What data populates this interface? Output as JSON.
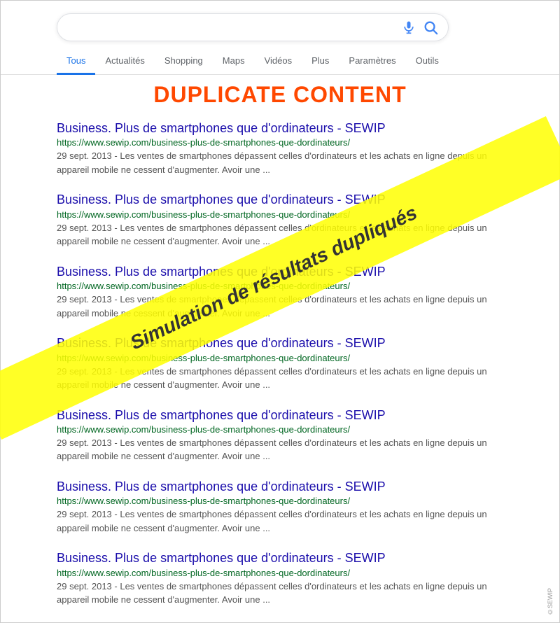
{
  "searchbar": {
    "placeholder": "",
    "value": ""
  },
  "nav": {
    "tabs": [
      {
        "label": "Tous",
        "active": true
      },
      {
        "label": "Actualités",
        "active": false
      },
      {
        "label": "Shopping",
        "active": false
      },
      {
        "label": "Maps",
        "active": false
      },
      {
        "label": "Vidéos",
        "active": false
      },
      {
        "label": "Plus",
        "active": false
      },
      {
        "label": "Paramètres",
        "active": false
      },
      {
        "label": "Outils",
        "active": false
      }
    ]
  },
  "header": {
    "title": "DUPLICATE CONTENT"
  },
  "banner": {
    "text": "Simulation de résultats dupliqués"
  },
  "results": [
    {
      "title": "Business. Plus de smartphones que d'ordinateurs - SEWIP",
      "url": "https://www.sewip.com/business-plus-de-smartphones-que-dordinateurs/",
      "snippet": "29 sept. 2013 - Les ventes de smartphones dépassent celles d'ordinateurs et les achats en ligne depuis un appareil mobile ne cessent d'augmenter. Avoir une ..."
    },
    {
      "title": "Business. Plus de smartphones que d'ordinateurs - SEWIP",
      "url": "https://www.sewip.com/business-plus-de-smartphones-que-dordinateurs/",
      "snippet": "29 sept. 2013 - Les ventes de smartphones dépassent celles d'ordinateurs et les achats en ligne depuis un appareil mobile ne cessent d'augmenter. Avoir une ..."
    },
    {
      "title": "Business. Plus de smartphones que d'ordinateurs - SEWIP",
      "url": "https://www.sewip.com/business-plus-de-smartphones-que-dordinateurs/",
      "snippet": "29 sept. 2013 - Les ventes de smartphones dépassent celles d'ordinateurs et les achats en ligne depuis un appareil mobile ne cessent d'augmenter. Avoir une ..."
    },
    {
      "title": "Business. Plus de smartphones que d'ordinateurs - SEWIP",
      "url": "https://www.sewip.com/business-plus-de-smartphones-que-dordinateurs/",
      "snippet": "29 sept. 2013 - Les ventes de smartphones dépassent celles d'ordinateurs et les achats en ligne depuis un appareil mobile ne cessent d'augmenter. Avoir une ..."
    },
    {
      "title": "Business. Plus de smartphones que d'ordinateurs - SEWIP",
      "url": "https://www.sewip.com/business-plus-de-smartphones-que-dordinateurs/",
      "snippet": "29 sept. 2013 - Les ventes de smartphones dépassent celles d'ordinateurs et les achats en ligne depuis un appareil mobile ne cessent d'augmenter. Avoir une ..."
    },
    {
      "title": "Business. Plus de smartphones que d'ordinateurs - SEWIP",
      "url": "https://www.sewip.com/business-plus-de-smartphones-que-dordinateurs/",
      "snippet": "29 sept. 2013 - Les ventes de smartphones dépassent celles d'ordinateurs et les achats en ligne depuis un appareil mobile ne cessent d'augmenter. Avoir une ..."
    },
    {
      "title": "Business. Plus de smartphones que d'ordinateurs - SEWIP",
      "url": "https://www.sewip.com/business-plus-de-smartphones-que-dordinateurs/",
      "snippet": "29 sept. 2013 - Les ventes de smartphones dépassent celles d'ordinateurs et les achats en ligne depuis un appareil mobile ne cessent d'augmenter. Avoir une ..."
    }
  ],
  "watermark": {
    "text": "©SEWIP"
  },
  "colors": {
    "accent_blue": "#1a73e8",
    "tab_active": "#1a0dab",
    "result_title": "#1a0dab",
    "result_url": "#006621",
    "result_snippet": "#545454",
    "header_color": "#ff4800",
    "banner_bg": "rgba(255,255,0,0.85)",
    "banner_text": "#333"
  }
}
